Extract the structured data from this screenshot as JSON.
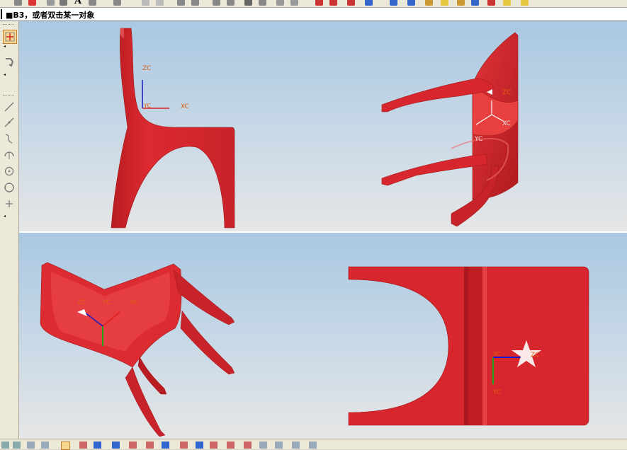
{
  "cue_line": {
    "text": "■B3，或者双击某一对象"
  },
  "axes_labels": {
    "x": "XC",
    "y": "YC",
    "z": "ZC"
  },
  "colors": {
    "model": "#d8262e",
    "model_shade": "#b81c22",
    "axis_x": "#e0201c",
    "axis_y": "#18a818",
    "axis_z": "#1818c8",
    "axis_label": "#e06010"
  },
  "left_toolbar_icons": [
    "snap-point-icon",
    "tool-icon",
    "line-icon",
    "line-diagonal-icon",
    "spline-icon",
    "arc-icon",
    "circle-dot-icon",
    "circle-icon",
    "point-icon"
  ],
  "top_toolbar": {
    "text_icon": "A"
  }
}
